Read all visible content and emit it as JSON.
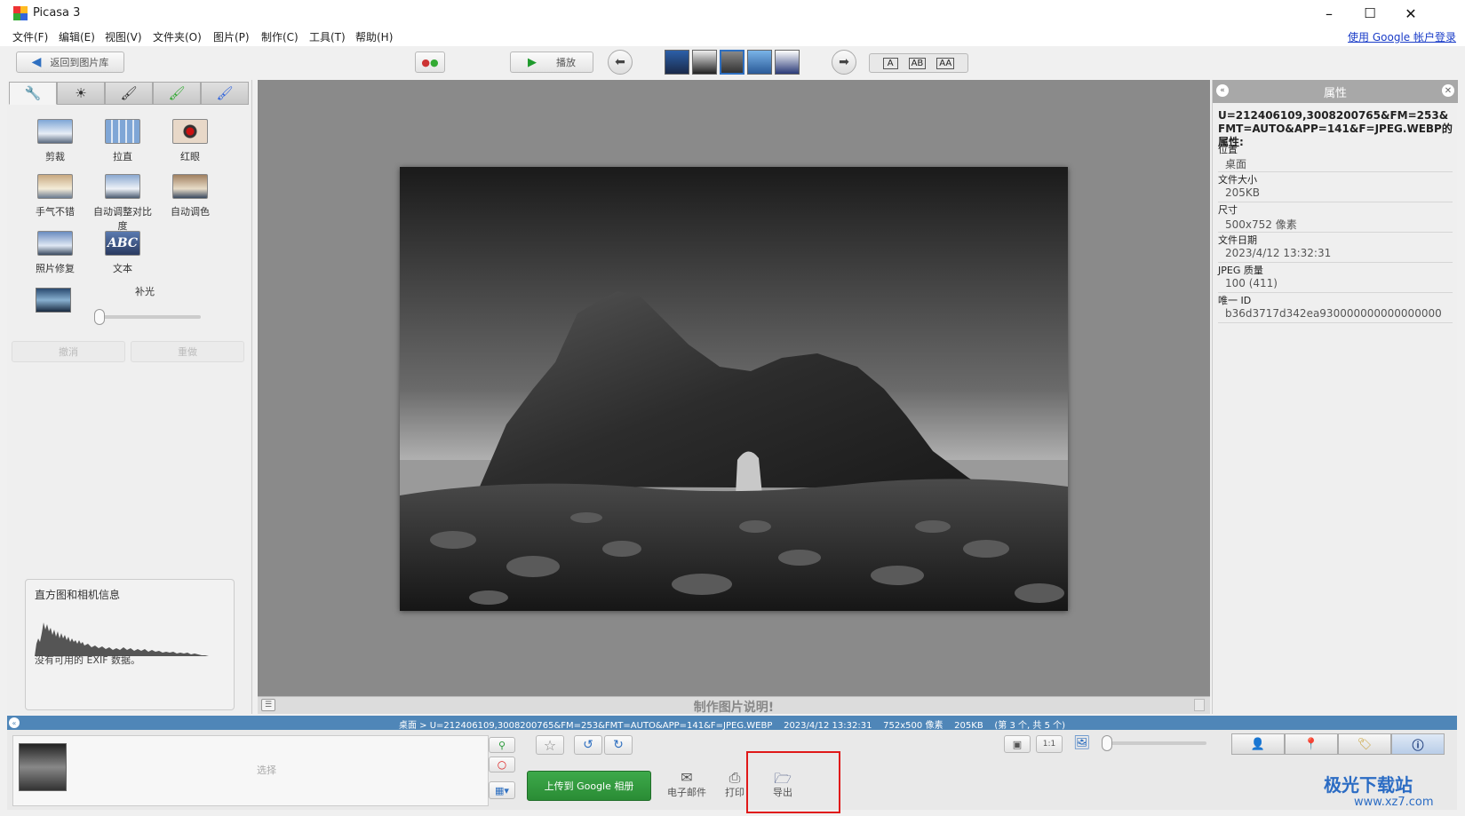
{
  "window": {
    "title": "Picasa 3",
    "minimize": "–",
    "maximize": "☐",
    "close": "✕"
  },
  "menu": {
    "items": [
      "文件(F)",
      "编辑(E)",
      "视图(V)",
      "文件夹(O)",
      "图片(P)",
      "制作(C)",
      "工具(T)",
      "帮助(H)"
    ],
    "login": "使用 Google 帐户登录"
  },
  "toolbar": {
    "back_label": "返回到图片库",
    "play_label": "播放",
    "caption_modes": [
      "A",
      "AB",
      "AA"
    ]
  },
  "left": {
    "tools": [
      {
        "label": "剪裁",
        "icon": "crop-icon"
      },
      {
        "label": "拉直",
        "icon": "straighten-icon"
      },
      {
        "label": "红眼",
        "icon": "redeye-icon"
      },
      {
        "label": "手气不错",
        "icon": "feeling-lucky-icon"
      },
      {
        "label": "自动调整对比度",
        "icon": "auto-contrast-icon"
      },
      {
        "label": "自动调色",
        "icon": "auto-color-icon"
      },
      {
        "label": "照片修复",
        "icon": "retouch-icon"
      },
      {
        "label": "文本",
        "icon": "text-icon"
      }
    ],
    "fill_light_label": "补光",
    "undo_label": "撤消",
    "redo_label": "重做",
    "hist_title": "直方图和相机信息",
    "no_exif": "没有可用的 EXIF 数据。"
  },
  "viewer": {
    "caption_prompt": "制作图片说明!"
  },
  "properties": {
    "header": "属性",
    "filename": "U=212406109,3008200765&FM=253&FMT=AUTO&APP=141&F=JPEG.WEBP的属性:",
    "rows": [
      {
        "key": "位置",
        "value": "桌面"
      },
      {
        "key": "文件大小",
        "value": "205KB"
      },
      {
        "key": "尺寸",
        "value": "500x752 像素"
      },
      {
        "key": "文件日期",
        "value": "2023/4/12 13:32:31"
      },
      {
        "key": "JPEG 质量",
        "value": "100 (411)"
      },
      {
        "key": "唯一 ID",
        "value": "b36d3717d342ea930000000000000000"
      }
    ]
  },
  "status": {
    "path": "桌面 > U=212406109,3008200765&FM=253&FMT=AUTO&APP=141&F=JPEG.WEBP",
    "date": "2023/4/12 13:32:31",
    "dims": "752x500 像素",
    "size": "205KB",
    "position": "(第 3 个, 共 5 个)"
  },
  "tray": {
    "select_label": "选择",
    "upload_label": "上传到 Google 相册",
    "email_label": "电子邮件",
    "print_label": "打印",
    "export_label": "导出"
  },
  "watermark": {
    "line1": "极光下载站",
    "line2": "www.xz7.com"
  }
}
